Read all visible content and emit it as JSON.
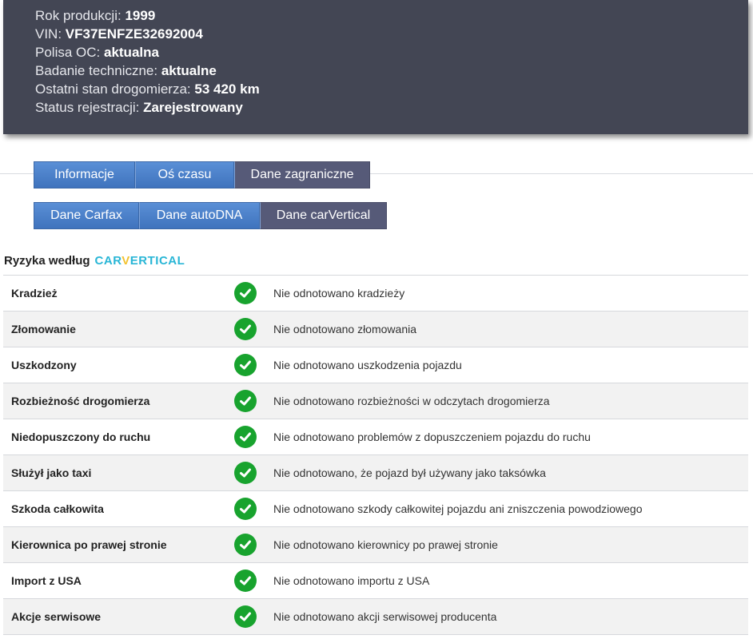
{
  "vehicle": {
    "rows": [
      {
        "label": "Rok produkcji:",
        "value": "1999"
      },
      {
        "label": "VIN:",
        "value": "VF37ENFZE32692004"
      },
      {
        "label": "Polisa OC:",
        "value": "aktualna"
      },
      {
        "label": "Badanie techniczne:",
        "value": "aktualne"
      },
      {
        "label": "Ostatni stan drogomierza:",
        "value": "53 420 km"
      },
      {
        "label": "Status rejestracji:",
        "value": "Zarejestrowany"
      }
    ]
  },
  "tabs_primary": [
    {
      "label": "Informacje",
      "active": false
    },
    {
      "label": "Oś czasu",
      "active": false
    },
    {
      "label": "Dane zagraniczne",
      "active": true
    }
  ],
  "tabs_secondary": [
    {
      "label": "Dane Carfax",
      "active": false
    },
    {
      "label": "Dane autoDNA",
      "active": false
    },
    {
      "label": "Dane carVertical",
      "active": true
    }
  ],
  "risks": {
    "title": "Ryzyka według",
    "brand_part1": "CAR",
    "brand_part2": "V",
    "brand_part3": "ERTICAL",
    "colors": {
      "brand": "#29b6d6",
      "brand_v": "#f2c230",
      "ok": "#18a32e"
    },
    "rows": [
      {
        "name": "Kradzież",
        "status_icon": "check-icon",
        "description": "Nie odnotowano kradzieży"
      },
      {
        "name": "Złomowanie",
        "status_icon": "check-icon",
        "description": "Nie odnotowano złomowania"
      },
      {
        "name": "Uszkodzony",
        "status_icon": "check-icon",
        "description": "Nie odnotowano uszkodzenia pojazdu"
      },
      {
        "name": "Rozbieżność drogomierza",
        "status_icon": "check-icon",
        "description": "Nie odnotowano rozbieżności w odczytach drogomierza"
      },
      {
        "name": "Niedopuszczony do ruchu",
        "status_icon": "check-icon",
        "description": "Nie odnotowano problemów z dopuszczeniem pojazdu do ruchu"
      },
      {
        "name": "Służył jako taxi",
        "status_icon": "check-icon",
        "description": "Nie odnotowano, że pojazd był używany jako taksówka"
      },
      {
        "name": "Szkoda całkowita",
        "status_icon": "check-icon",
        "description": "Nie odnotowano szkody całkowitej pojazdu ani zniszczenia powodziowego"
      },
      {
        "name": "Kierownica po prawej stronie",
        "status_icon": "check-icon",
        "description": "Nie odnotowano kierownicy po prawej stronie"
      },
      {
        "name": "Import z USA",
        "status_icon": "check-icon",
        "description": "Nie odnotowano importu z USA"
      },
      {
        "name": "Akcje serwisowe",
        "status_icon": "check-icon",
        "description": "Nie odnotowano akcji serwisowej producenta"
      }
    ]
  }
}
